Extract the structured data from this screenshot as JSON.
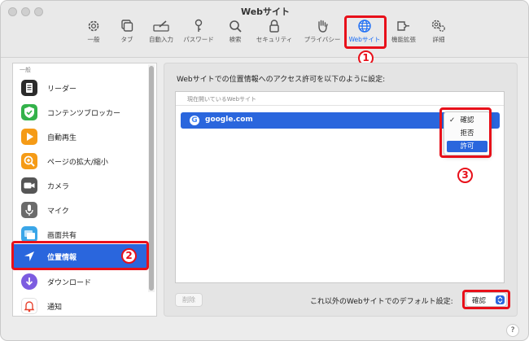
{
  "window": {
    "title": "Webサイト"
  },
  "toolbar": {
    "items": [
      {
        "label": "一般",
        "icon": "gear-icon"
      },
      {
        "label": "タブ",
        "icon": "tabs-icon"
      },
      {
        "label": "自動入力",
        "icon": "autofill-icon"
      },
      {
        "label": "パスワード",
        "icon": "key-icon"
      },
      {
        "label": "検索",
        "icon": "search-icon"
      },
      {
        "label": "セキュリティ",
        "icon": "lock-icon"
      },
      {
        "label": "プライバシー",
        "icon": "hand-icon"
      },
      {
        "label": "Webサイト",
        "icon": "globe-icon",
        "selected": true
      },
      {
        "label": "機能拡張",
        "icon": "extensions-icon"
      },
      {
        "label": "詳細",
        "icon": "advanced-gear-icon"
      }
    ]
  },
  "annotations": {
    "one": "1",
    "two": "2",
    "three": "3",
    "color": "#e8101a"
  },
  "sidebar": {
    "header": "一般",
    "items": [
      {
        "label": "リーダー",
        "icon": "reader-icon",
        "color": "#2b2b2b"
      },
      {
        "label": "コンテンツブロッカー",
        "icon": "content-blocker-icon",
        "color": "#33b24a"
      },
      {
        "label": "自動再生",
        "icon": "autoplay-icon",
        "color": "#f59b16"
      },
      {
        "label": "ページの拡大/縮小",
        "icon": "zoom-icon",
        "color": "#f59b16"
      },
      {
        "label": "カメラ",
        "icon": "camera-icon",
        "color": "#565656"
      },
      {
        "label": "マイク",
        "icon": "microphone-icon",
        "color": "#6b6b6b"
      },
      {
        "label": "画面共有",
        "icon": "screen-sharing-icon",
        "color": "#3aa6e8"
      },
      {
        "label": "位置情報",
        "icon": "location-icon",
        "color": "#2a66dd",
        "selected": true
      },
      {
        "label": "ダウンロード",
        "icon": "download-icon",
        "color": "#7c5ce0"
      },
      {
        "label": "通知",
        "icon": "notification-icon",
        "color": "#e8432f"
      }
    ]
  },
  "main": {
    "description": "Webサイトでの位置情報へのアクセス許可を以下のように設定:",
    "list_header": "現在開いているWebサイト",
    "site": "google.com",
    "google_letter": "G",
    "menu": {
      "checkmark": "✓",
      "options": [
        "確認",
        "拒否",
        "許可"
      ],
      "checked_index": 0,
      "highlighted_index": 2
    },
    "delete_label": "削除",
    "default_label": "これ以外のWebサイトでのデフォルト設定:",
    "default_value": "確認",
    "help_label": "?"
  },
  "colors": {
    "accent": "#2a66dd",
    "highlight": "#e8101a"
  }
}
